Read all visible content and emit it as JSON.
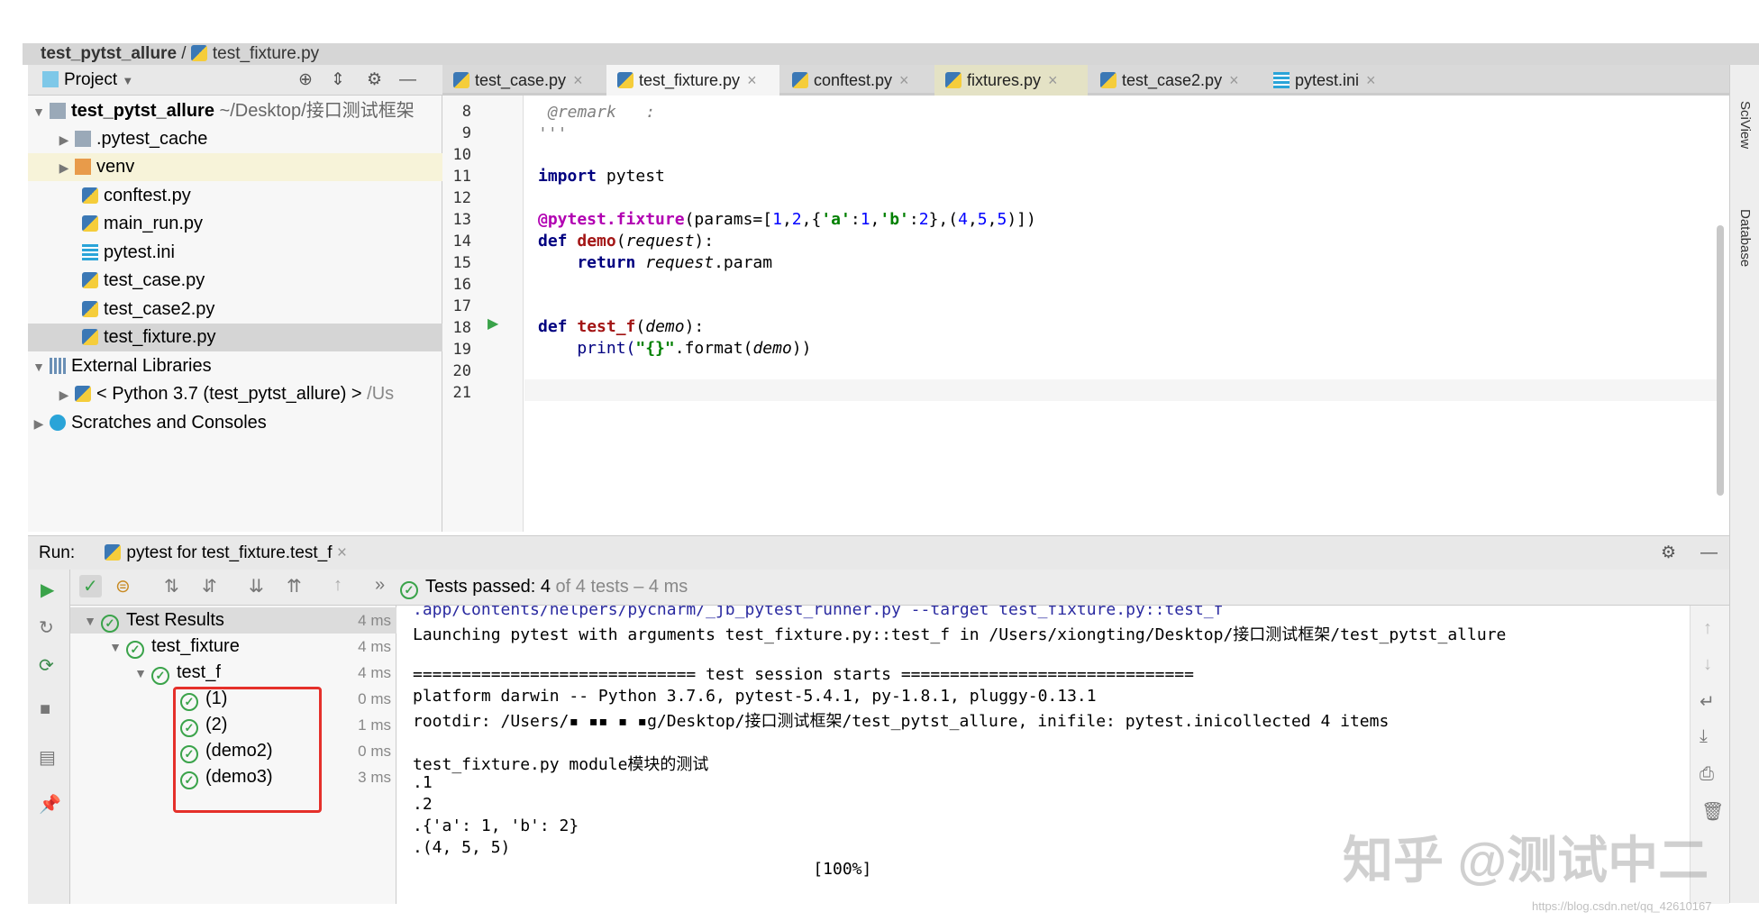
{
  "breadcrumb": {
    "project": "test_pytst_allure",
    "file": "test_fixture.py"
  },
  "project_panel": {
    "title": "Project",
    "tree": [
      {
        "label": "test_pytst_allure",
        "extra": "~/Desktop/接口测试框架",
        "type": "root"
      },
      {
        "label": ".pytest_cache",
        "type": "folder"
      },
      {
        "label": "venv",
        "type": "folder-open"
      },
      {
        "label": "conftest.py",
        "type": "py"
      },
      {
        "label": "main_run.py",
        "type": "py"
      },
      {
        "label": "pytest.ini",
        "type": "ini"
      },
      {
        "label": "test_case.py",
        "type": "py"
      },
      {
        "label": "test_case2.py",
        "type": "py"
      },
      {
        "label": "test_fixture.py",
        "type": "py",
        "selected": true
      },
      {
        "label": "External Libraries",
        "type": "lib"
      },
      {
        "label": "< Python 3.7 (test_pytst_allure) >",
        "extra": "/Us",
        "type": "py"
      },
      {
        "label": "Scratches and Consoles",
        "type": "scratch"
      }
    ]
  },
  "tabs": [
    {
      "label": "test_case.py"
    },
    {
      "label": "test_fixture.py",
      "active": true
    },
    {
      "label": "conftest.py"
    },
    {
      "label": "fixtures.py"
    },
    {
      "label": "test_case2.py"
    },
    {
      "label": "pytest.ini"
    }
  ],
  "editor": {
    "line_numbers": [
      "8",
      "9",
      "10",
      "11",
      "12",
      "13",
      "14",
      "15",
      "16",
      "17",
      "18",
      "19",
      "20",
      "21"
    ],
    "code": {
      "l8": "@remark   :",
      "l9": "'''",
      "l11a": "import",
      "l11b": " pytest",
      "l13a": "@pytest.fixture",
      "l13b": "(params=[",
      "l13c": "1",
      "l13d": ",",
      "l13e": "2",
      "l13f": ",{",
      "l13g": "'a'",
      "l13h": ":",
      "l13i": "1",
      "l13j": ",",
      "l13k": "'b'",
      "l13l": ":",
      "l13m": "2",
      "l13n": "},(",
      "l13o": "4",
      "l13p": ",",
      "l13q": "5",
      "l13r": ",",
      "l13s": "5",
      "l13t": ")])",
      "l14a": "def ",
      "l14b": "demo",
      "l14c": "(",
      "l14d": "request",
      "l14e": "):",
      "l15a": "    return ",
      "l15b": "request",
      "l15c": ".param",
      "l18a": "def ",
      "l18b": "test_f",
      "l18c": "(",
      "l18d": "demo",
      "l18e": "):",
      "l19a": "    print(",
      "l19b": "\"{}\"",
      "l19c": ".format(",
      "l19d": "demo",
      "l19e": "))"
    }
  },
  "side_tools": {
    "sciview": "SciView",
    "database": "Database"
  },
  "run": {
    "label": "Run:",
    "config": "pytest for test_fixture.test_f",
    "status_prefix": "Tests passed:",
    "passed": "4",
    "status_suffix": "of 4 tests – 4 ms",
    "tree": [
      {
        "label": "Test Results",
        "time": "4 ms"
      },
      {
        "label": "test_fixture",
        "time": "4 ms"
      },
      {
        "label": "test_f",
        "time": "4 ms"
      },
      {
        "label": "(1)",
        "time": "0 ms"
      },
      {
        "label": "(2)",
        "time": "1 ms"
      },
      {
        "label": "(demo2)",
        "time": "0 ms"
      },
      {
        "label": "(demo3)",
        "time": "3 ms"
      }
    ],
    "console": [
      ".app/Contents/helpers/pycharm/_jb_pytest_runner.py --target test_fixture.py::test_f",
      "Launching pytest with arguments test_fixture.py::test_f in /Users/xiongting/Desktop/接口测试框架/test_pytst_allure",
      "",
      "============================= test session starts ==============================",
      "platform darwin -- Python 3.7.6, pytest-5.4.1, py-1.8.1, pluggy-0.13.1",
      "rootdir: /Users/▪ ▪▪ ▪ ▪g/Desktop/接口测试框架/test_pytst_allure, inifile: pytest.inicollected 4 items",
      "",
      "test_fixture.py module模块的测试",
      ".1",
      ".2",
      ".{'a': 1, 'b': 2}",
      ".(4, 5, 5)",
      "                                         [100%]"
    ]
  },
  "watermark": "知乎 @测试中二",
  "watermark_url": "https://blog.csdn.net/qq_42610167",
  "colors": {
    "pass": "#3aa34a",
    "highlight_box": "#e5302a"
  }
}
